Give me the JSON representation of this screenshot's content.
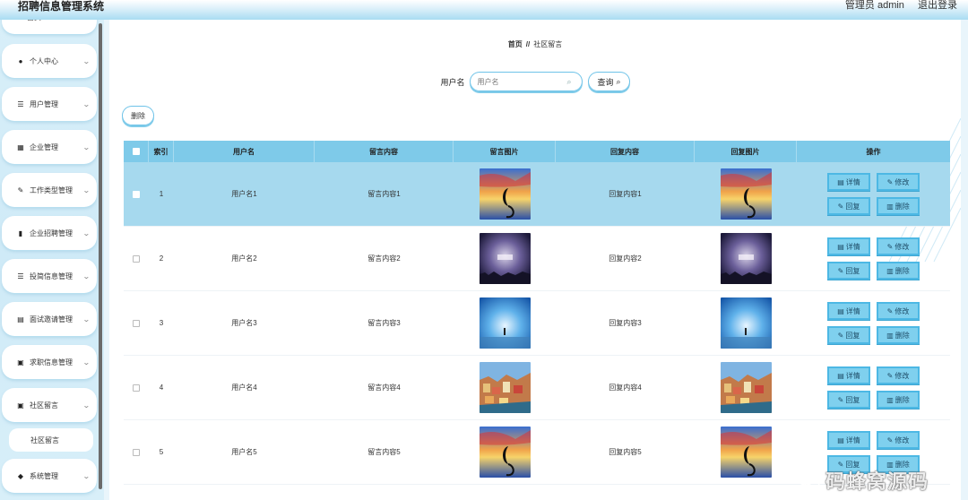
{
  "header": {
    "title": "招聘信息管理系统",
    "user": "管理员 admin",
    "logout": "退出登录"
  },
  "sidebar": {
    "top_partial": "首页",
    "items": [
      {
        "label": "个人中心",
        "icon": "user-icon"
      },
      {
        "label": "用户管理",
        "icon": "list-icon"
      },
      {
        "label": "企业管理",
        "icon": "grid-icon"
      },
      {
        "label": "工作类型管理",
        "icon": "edit-icon"
      },
      {
        "label": "企业招聘管理",
        "icon": "book-icon"
      },
      {
        "label": "投简信息管理",
        "icon": "list-icon"
      },
      {
        "label": "面试邀请管理",
        "icon": "doc-icon"
      },
      {
        "label": "求职信息管理",
        "icon": "apps-icon"
      },
      {
        "label": "社区留言",
        "icon": "apps-icon"
      },
      {
        "label": "系统管理",
        "icon": "ticket-icon"
      }
    ],
    "submenu": {
      "label": "社区留言"
    }
  },
  "breadcrumb": {
    "home": "首页",
    "separator": "//",
    "current": "社区留言"
  },
  "search": {
    "label": "用户名",
    "placeholder": "用户名",
    "query_label": "查询"
  },
  "toolbar": {
    "delete_label": "删除"
  },
  "table": {
    "headers": [
      "索引",
      "用户名",
      "留言内容",
      "留言图片",
      "回复内容",
      "回复图片",
      "操作"
    ],
    "rows": [
      {
        "index": "1",
        "username": "用户名1",
        "content": "留言内容1",
        "reply": "回复内容1",
        "image": "sunset"
      },
      {
        "index": "2",
        "username": "用户名2",
        "content": "留言内容2",
        "reply": "回复内容2",
        "image": "night"
      },
      {
        "index": "3",
        "username": "用户名3",
        "content": "留言内容3",
        "reply": "回复内容3",
        "image": "sky"
      },
      {
        "index": "4",
        "username": "用户名4",
        "content": "留言内容4",
        "reply": "回复内容4",
        "image": "town"
      },
      {
        "index": "5",
        "username": "用户名5",
        "content": "留言内容5",
        "reply": "回复内容5",
        "image": "sunset"
      }
    ],
    "actions": {
      "detail": "详情",
      "edit": "修改",
      "reply": "回复",
      "delete": "删除"
    }
  },
  "watermark": "码蜂窝源码",
  "colors": {
    "accent": "#7ecae9",
    "button": "#7fd0ee",
    "selected_row": "#a6d9ee",
    "sidebar_bg": "#d8eff9"
  }
}
